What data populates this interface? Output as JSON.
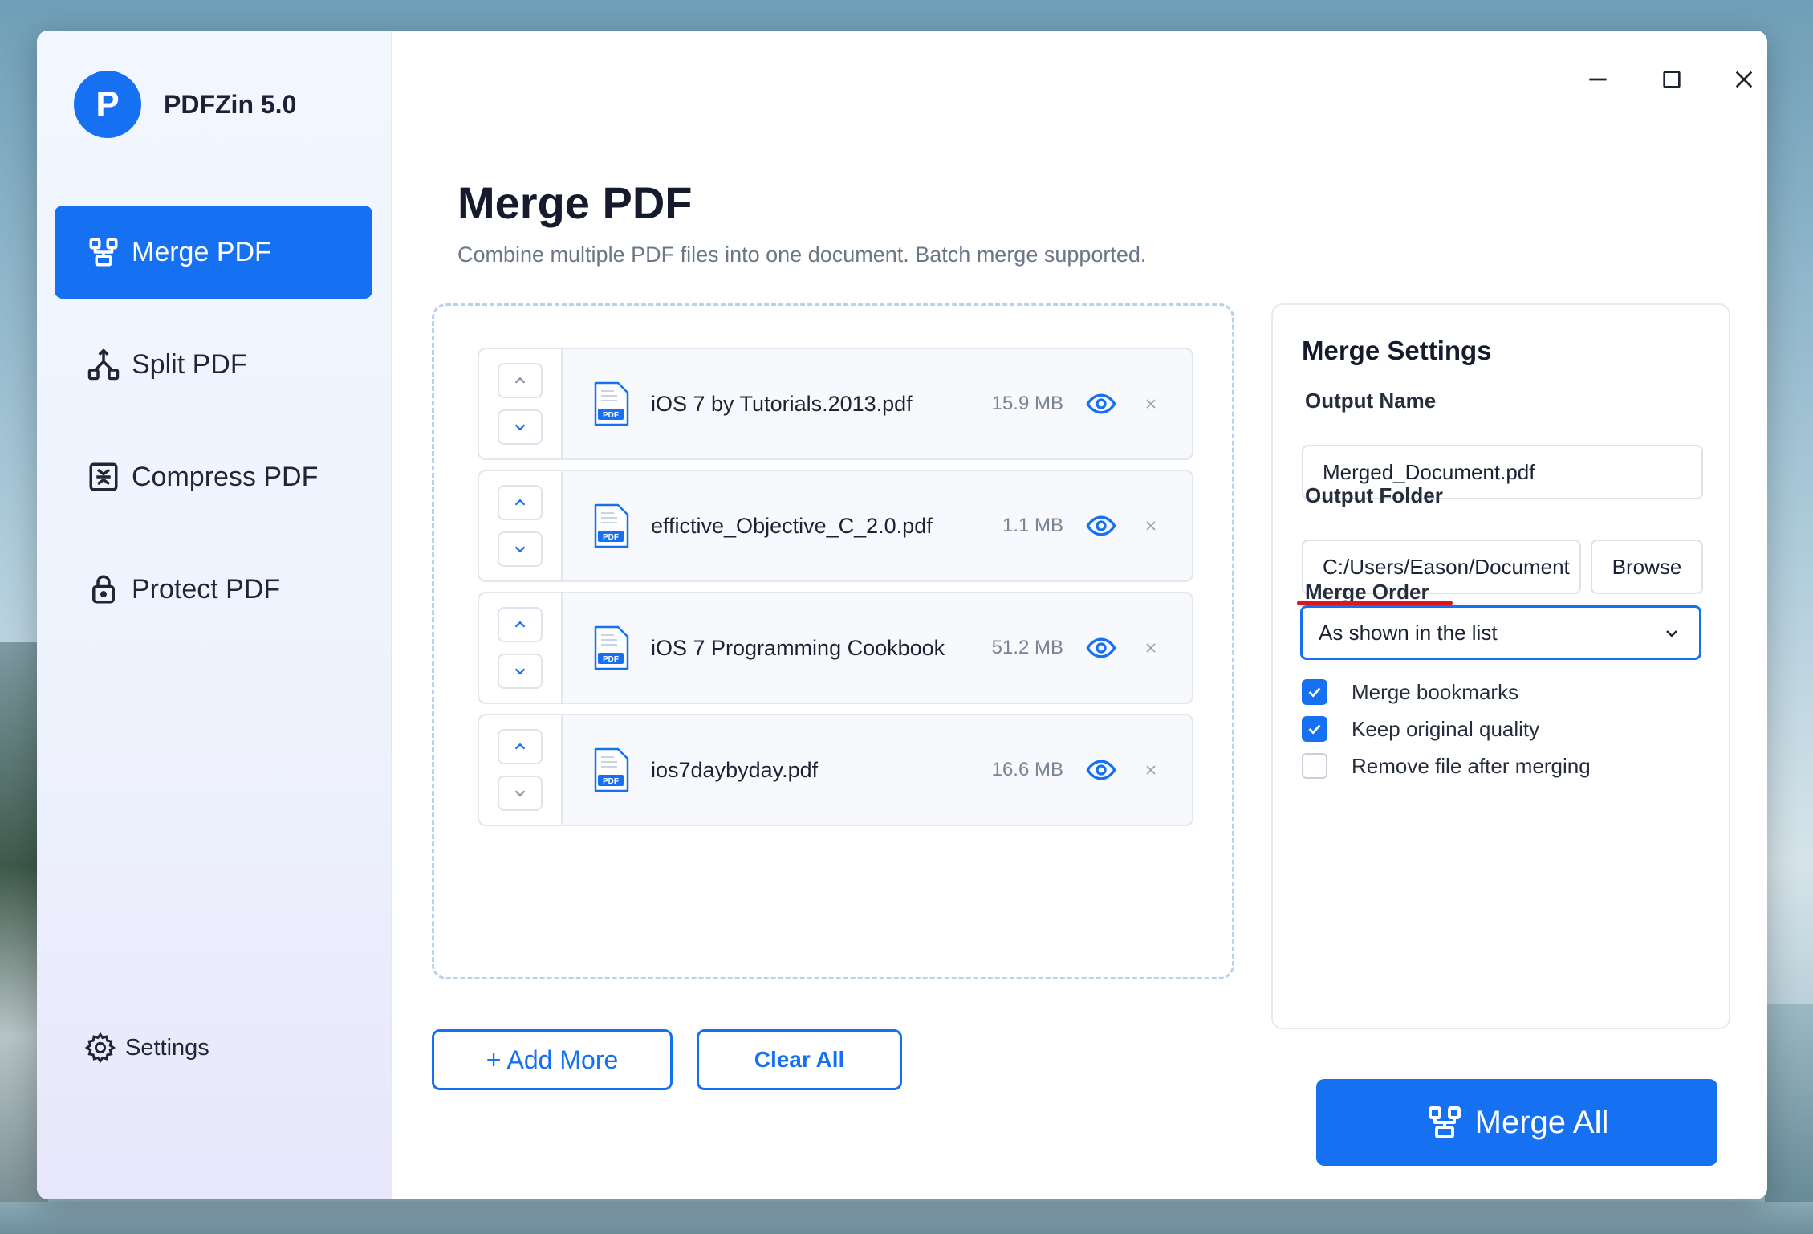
{
  "app": {
    "logo_letter": "P",
    "name": "PDFZin 5.0"
  },
  "sidebar": {
    "items": [
      {
        "label": "Merge PDF",
        "icon": "merge-icon",
        "active": true
      },
      {
        "label": "Split PDF",
        "icon": "split-icon",
        "active": false
      },
      {
        "label": "Compress PDF",
        "icon": "compress-icon",
        "active": false
      },
      {
        "label": "Protect PDF",
        "icon": "lock-icon",
        "active": false
      }
    ],
    "settings_label": "Settings"
  },
  "window_controls": [
    "minimize-icon",
    "maximize-icon",
    "close-icon"
  ],
  "main": {
    "title": "Merge PDF",
    "subtitle": "Combine multiple PDF files into one document. Batch merge supported.",
    "files": [
      {
        "name": "iOS 7 by Tutorials.2013.pdf",
        "size": "15.9 MB",
        "icon_label": "PDF"
      },
      {
        "name": "effictive_Objective_C_2.0.pdf",
        "size": "1.1 MB",
        "icon_label": "PDF"
      },
      {
        "name": "iOS 7 Programming Cookbook",
        "size": "51.2 MB",
        "icon_label": "PDF"
      },
      {
        "name": "ios7daybyday.pdf",
        "size": "16.6 MB",
        "icon_label": "PDF"
      }
    ],
    "add_more_label": "+ Add More",
    "clear_all_label": "Clear All"
  },
  "settings_panel": {
    "title": "Merge Settings",
    "output_name_label": "Output Name",
    "output_name_value": "Merged_Document.pdf",
    "output_folder_label": "Output Folder",
    "output_folder_value": "C:/Users/Eason/Document",
    "browse_label": "Browse",
    "merge_order_label": "Merge Order",
    "merge_order_value": "As shown in the list",
    "options": [
      {
        "label": "Merge bookmarks",
        "checked": true
      },
      {
        "label": "Keep original quality",
        "checked": true
      },
      {
        "label": "Remove file after merging",
        "checked": false
      }
    ]
  },
  "primary_action": {
    "label": "Merge All"
  },
  "colors": {
    "accent": "#1570f2",
    "annotation_underline": "#e0161f"
  }
}
